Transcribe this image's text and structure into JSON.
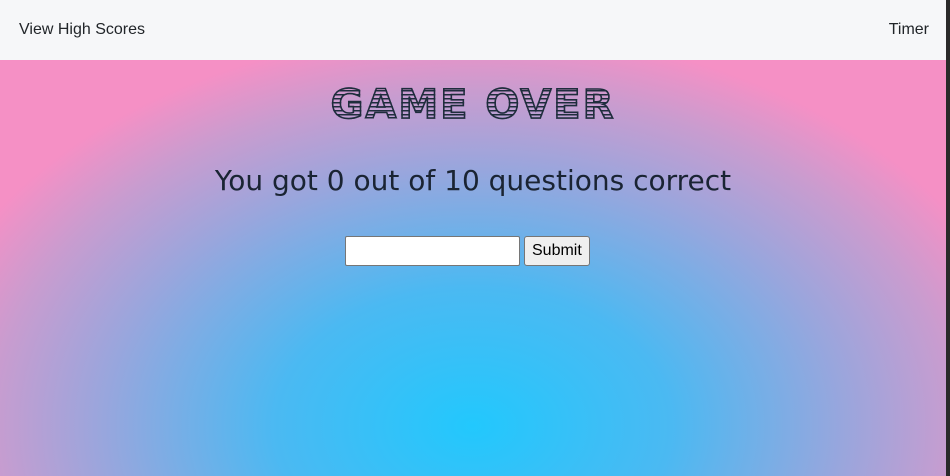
{
  "navbar": {
    "high_scores_link": "View High Scores",
    "timer_label": "Timer"
  },
  "game_over": {
    "title": "GAME OVER",
    "result_text": "You got 0 out of 10 questions correct"
  },
  "form": {
    "initials_value": "",
    "initials_placeholder": "",
    "submit_label": "Submit"
  },
  "colors": {
    "navbar_bg": "#f6f7f9",
    "gradient_center": "#22c8fd",
    "gradient_edge": "#f590c5",
    "title_color": "#1f2d3d"
  }
}
